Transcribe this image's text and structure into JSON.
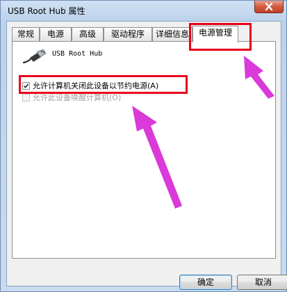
{
  "window": {
    "title": "USB Root Hub 属性",
    "close_icon": "close-x-icon"
  },
  "tabs": [
    {
      "label": "常规",
      "active": false
    },
    {
      "label": "电源",
      "active": false
    },
    {
      "label": "高级",
      "active": false
    },
    {
      "label": "驱动程序",
      "active": false
    },
    {
      "label": "详细信息",
      "active": false
    },
    {
      "label": "电源管理",
      "active": true
    }
  ],
  "device": {
    "icon": "usb-connector-icon",
    "name": "USB Root Hub"
  },
  "options": [
    {
      "label": "允许计算机关闭此设备以节约电源(A)",
      "checked": true,
      "enabled": true
    },
    {
      "label": "允许此设备唤醒计算机(O)",
      "checked": false,
      "enabled": false
    }
  ],
  "buttons": {
    "ok": "确定",
    "cancel": "取消"
  },
  "colors": {
    "highlight": "#e8001c",
    "arrow": "#d93ad8"
  }
}
